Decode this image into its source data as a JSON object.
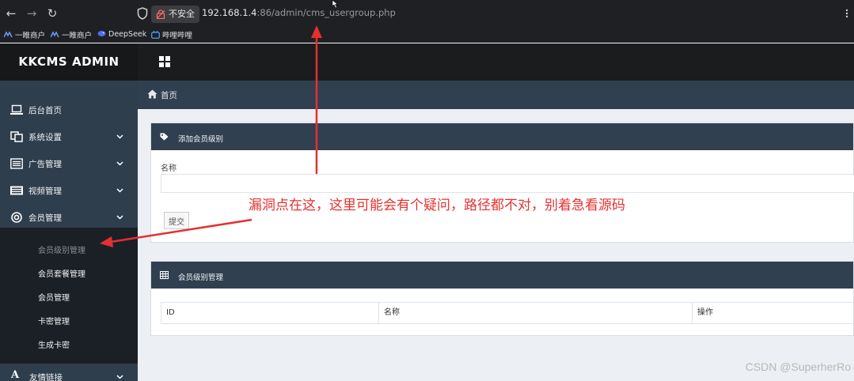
{
  "browser": {
    "back_icon": "←",
    "forward_icon": "→",
    "reload_icon": "↻",
    "insecure_label": "不安全",
    "url_host": "192.168.1.4",
    "url_rest": ":86/admin/cms_usergroup.php"
  },
  "bookmarks": [
    {
      "label": "一睢商户"
    },
    {
      "label": "一睢商户"
    },
    {
      "label": "DeepSeek"
    },
    {
      "label": "哔哩哔哩"
    }
  ],
  "admin": {
    "logo": "KKCMS ADMIN"
  },
  "sidebar": {
    "items": [
      {
        "label": "后台首页",
        "icon": "laptop-icon"
      },
      {
        "label": "系统设置",
        "icon": "settings-copy-icon"
      },
      {
        "label": "广告管理",
        "icon": "list-icon"
      },
      {
        "label": "视频管理",
        "icon": "film-icon"
      },
      {
        "label": "会员管理",
        "icon": "lifebuoy-icon"
      }
    ],
    "subitems": [
      {
        "label": "会员级别管理",
        "active": true
      },
      {
        "label": "会员套餐管理"
      },
      {
        "label": "会员管理"
      },
      {
        "label": "卡密管理"
      },
      {
        "label": "生成卡密"
      }
    ],
    "bottom_item": "友情链接"
  },
  "breadcrumb": {
    "label": "首页"
  },
  "add_panel": {
    "title": "添加会员级别",
    "name_label": "名称",
    "name_value": "",
    "submit_label": "提交"
  },
  "list_panel": {
    "title": "会员级别管理",
    "columns": [
      "ID",
      "名称",
      "操作"
    ]
  },
  "annotation": {
    "text": "漏洞点在这，这里可能会有个疑问，路径都不对，别着急看源码",
    "color": "#e53030"
  },
  "watermark": "CSDN @SuperherRo",
  "colors": {
    "sidebar": "#2f3e4d",
    "submenu": "#1b2026",
    "panel_header": "#304050"
  }
}
